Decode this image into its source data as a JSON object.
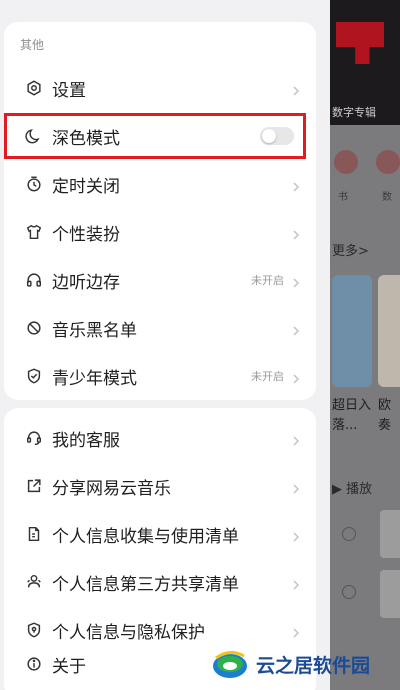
{
  "drawer": {
    "section_other": "其他",
    "items": [
      {
        "label": "设置",
        "icon": "gear-icon",
        "status": ""
      },
      {
        "label": "深色模式",
        "icon": "moon-icon",
        "status": "",
        "toggle": false
      },
      {
        "label": "定时关闭",
        "icon": "timer-icon",
        "status": ""
      },
      {
        "label": "个性装扮",
        "icon": "tshirt-icon",
        "status": ""
      },
      {
        "label": "边听边存",
        "icon": "headphones-icon",
        "status": "未开启"
      },
      {
        "label": "音乐黑名单",
        "icon": "block-icon",
        "status": ""
      },
      {
        "label": "青少年模式",
        "icon": "shield-icon",
        "status": "未开启"
      }
    ],
    "items2": [
      {
        "label": "我的客服",
        "icon": "headset-icon"
      },
      {
        "label": "分享网易云音乐",
        "icon": "share-icon"
      },
      {
        "label": "个人信息收集与使用清单",
        "icon": "doc-list-icon"
      },
      {
        "label": "个人信息第三方共享清单",
        "icon": "share-people-icon"
      },
      {
        "label": "个人信息与隐私保护",
        "icon": "privacy-icon"
      },
      {
        "label": "关于",
        "icon": "info-icon"
      }
    ]
  },
  "background": {
    "banner_tag": "数字专辑",
    "more": "更多>",
    "play": "播放",
    "card_text_1": "超日入",
    "card_text_1b": "落...",
    "card_text_2": "欧",
    "card_text_2b": "奏",
    "small_1": "书",
    "small_2": "数"
  },
  "watermark": {
    "text": "云之居软件园"
  },
  "colors": {
    "highlight": "#e21a22",
    "watermark": "#1b4a97"
  }
}
